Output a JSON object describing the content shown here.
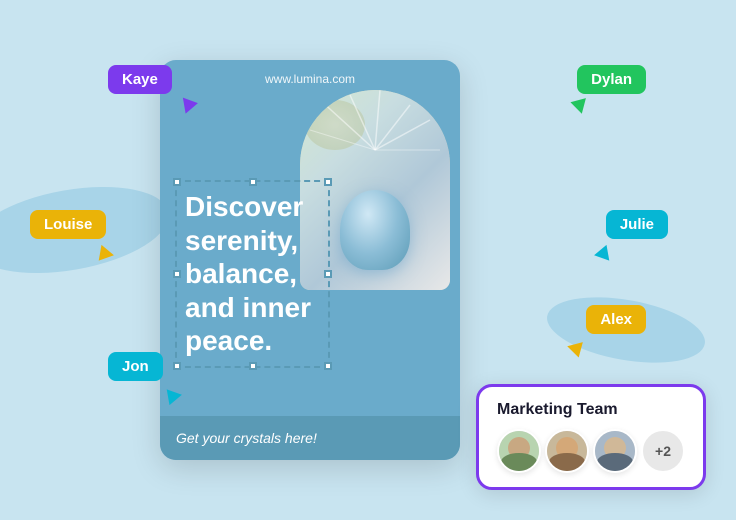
{
  "background_color": "#c8e4f0",
  "card": {
    "url": "www.lumina.com",
    "headline": "Discover serenity, balance, and inner peace.",
    "footer_text": "Get your crystals here!"
  },
  "name_tags": [
    {
      "name": "Kaye",
      "color": "#7c3aed"
    },
    {
      "name": "Dylan",
      "color": "#22c55e"
    },
    {
      "name": "Louise",
      "color": "#eab308"
    },
    {
      "name": "Julie",
      "color": "#06b6d4"
    },
    {
      "name": "Alex",
      "color": "#eab308"
    },
    {
      "name": "Jon",
      "color": "#06b6d4"
    }
  ],
  "marketing_team": {
    "title": "Marketing Team",
    "plus_count": "+2"
  }
}
